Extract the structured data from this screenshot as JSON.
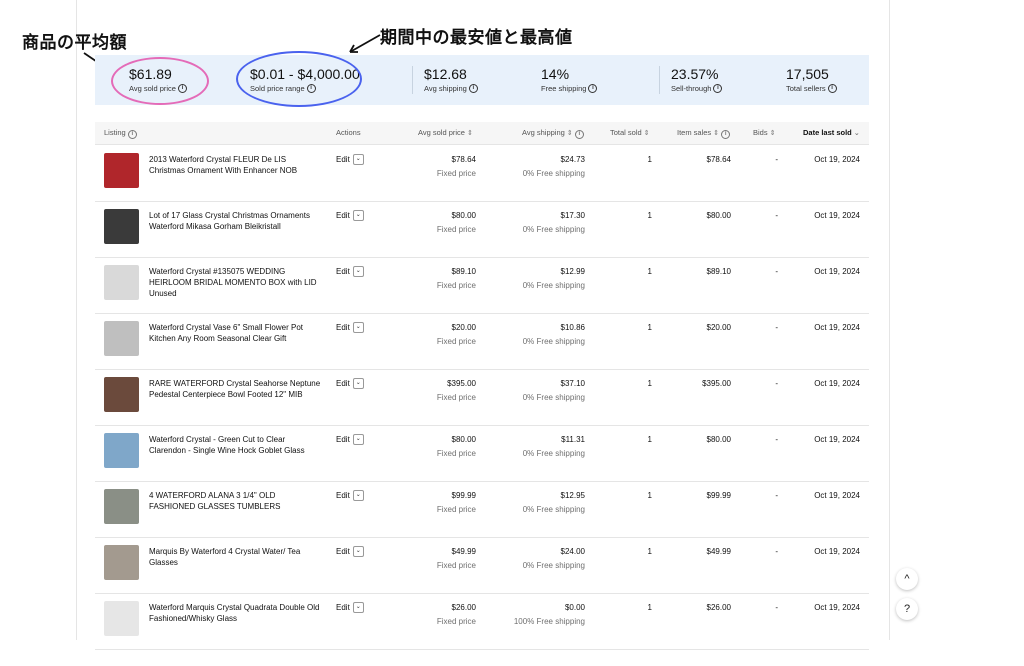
{
  "annotations": {
    "left": "商品の平均額",
    "right": "期間中の最安値と最高値"
  },
  "summary": [
    {
      "value": "$61.89",
      "label": "Avg sold price"
    },
    {
      "value": "$0.01 - $4,000.00",
      "label": "Sold price range"
    },
    {
      "value": "$12.68",
      "label": "Avg shipping"
    },
    {
      "value": "14%",
      "label": "Free shipping"
    },
    {
      "value": "23.57%",
      "label": "Sell-through"
    },
    {
      "value": "17,505",
      "label": "Total sellers"
    }
  ],
  "table": {
    "headers": {
      "listing": "Listing",
      "actions": "Actions",
      "avg_sold_price": "Avg sold price",
      "avg_shipping": "Avg shipping",
      "total_sold": "Total sold",
      "item_sales": "Item sales",
      "bids": "Bids",
      "date_last_sold": "Date last sold"
    },
    "rows": [
      {
        "title": "2013 Waterford Crystal FLEUR De LIS Christmas Ornament With Enhancer NOB",
        "edit": "Edit",
        "price": "$78.64",
        "price_type": "Fixed price",
        "shipping": "$24.73",
        "free_shipping": "0% Free shipping",
        "total_sold": "1",
        "item_sales": "$78.64",
        "bids": "-",
        "date": "Oct 19, 2024",
        "thumb_color": "#b0262b"
      },
      {
        "title": "Lot of 17 Glass Crystal Christmas Ornaments Waterford Mikasa Gorham Bleikristall",
        "edit": "Edit",
        "price": "$80.00",
        "price_type": "Fixed price",
        "shipping": "$17.30",
        "free_shipping": "0% Free shipping",
        "total_sold": "1",
        "item_sales": "$80.00",
        "bids": "-",
        "date": "Oct 19, 2024",
        "thumb_color": "#3a3a3a"
      },
      {
        "title": "Waterford Crystal #135075 WEDDING HEIRLOOM BRIDAL MOMENTO BOX with LID Unused",
        "edit": "Edit",
        "price": "$89.10",
        "price_type": "Fixed price",
        "shipping": "$12.99",
        "free_shipping": "0% Free shipping",
        "total_sold": "1",
        "item_sales": "$89.10",
        "bids": "-",
        "date": "Oct 19, 2024",
        "thumb_color": "#d9d9d9"
      },
      {
        "title": "Waterford Crystal Vase 6\" Small Flower Pot Kitchen Any Room Seasonal Clear Gift",
        "edit": "Edit",
        "price": "$20.00",
        "price_type": "Fixed price",
        "shipping": "$10.86",
        "free_shipping": "0% Free shipping",
        "total_sold": "1",
        "item_sales": "$20.00",
        "bids": "-",
        "date": "Oct 19, 2024",
        "thumb_color": "#bfbfbf"
      },
      {
        "title": "RARE WATERFORD Crystal Seahorse Neptune Pedestal Centerpiece Bowl Footed 12\" MIB",
        "edit": "Edit",
        "price": "$395.00",
        "price_type": "Fixed price",
        "shipping": "$37.10",
        "free_shipping": "0% Free shipping",
        "total_sold": "1",
        "item_sales": "$395.00",
        "bids": "-",
        "date": "Oct 19, 2024",
        "thumb_color": "#6b4a3c"
      },
      {
        "title": "Waterford Crystal - Green Cut to Clear Clarendon - Single Wine Hock Goblet Glass",
        "edit": "Edit",
        "price": "$80.00",
        "price_type": "Fixed price",
        "shipping": "$11.31",
        "free_shipping": "0% Free shipping",
        "total_sold": "1",
        "item_sales": "$80.00",
        "bids": "-",
        "date": "Oct 19, 2024",
        "thumb_color": "#7fa7c9"
      },
      {
        "title": "4 WATERFORD ALANA 3 1/4\" OLD FASHIONED GLASSES TUMBLERS",
        "edit": "Edit",
        "price": "$99.99",
        "price_type": "Fixed price",
        "shipping": "$12.95",
        "free_shipping": "0% Free shipping",
        "total_sold": "1",
        "item_sales": "$99.99",
        "bids": "-",
        "date": "Oct 19, 2024",
        "thumb_color": "#8a8f86"
      },
      {
        "title": "Marquis By Waterford 4 Crystal Water/ Tea Glasses",
        "edit": "Edit",
        "price": "$49.99",
        "price_type": "Fixed price",
        "shipping": "$24.00",
        "free_shipping": "0% Free shipping",
        "total_sold": "1",
        "item_sales": "$49.99",
        "bids": "-",
        "date": "Oct 19, 2024",
        "thumb_color": "#a39a8f"
      },
      {
        "title": "Waterford Marquis Crystal Quadrata Double Old Fashioned/Whisky Glass",
        "edit": "Edit",
        "price": "$26.00",
        "price_type": "Fixed price",
        "shipping": "$0.00",
        "free_shipping": "100% Free shipping",
        "total_sold": "1",
        "item_sales": "$26.00",
        "bids": "-",
        "date": "Oct 19, 2024",
        "thumb_color": "#e6e6e6"
      }
    ]
  },
  "fabs": {
    "up": "^",
    "help": "?"
  }
}
